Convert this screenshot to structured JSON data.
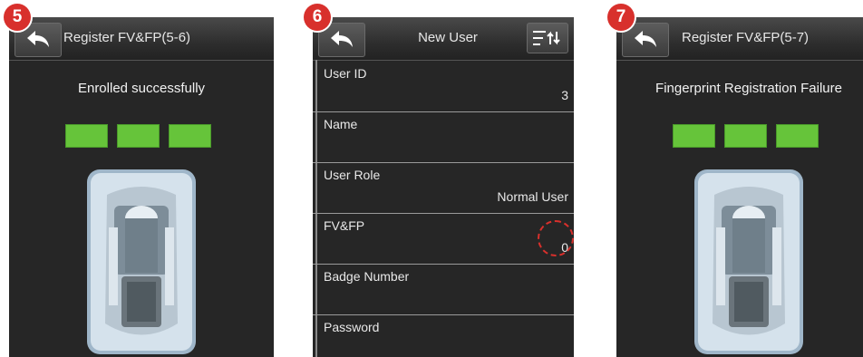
{
  "screens": [
    {
      "step": "5",
      "title": "Register FV&FP(5-6)",
      "message": "Enrolled successfully",
      "progress_filled": 3,
      "progress_total": 3
    },
    {
      "step": "6",
      "title": "New User",
      "fields": [
        {
          "label": "User ID",
          "value": "3"
        },
        {
          "label": "Name",
          "value": ""
        },
        {
          "label": "User Role",
          "value": "Normal User"
        },
        {
          "label": "FV&FP",
          "value": "0"
        },
        {
          "label": "Badge Number",
          "value": ""
        },
        {
          "label": "Password",
          "value": ""
        }
      ]
    },
    {
      "step": "7",
      "title": "Register FV&FP(5-7)",
      "message": "Fingerprint Registration Failure",
      "progress_filled": 3,
      "progress_total": 3
    }
  ],
  "icons": {
    "back": "back-arrow-icon",
    "sort": "sort-icon",
    "device": "fingerprint-scanner-icon"
  },
  "colors": {
    "screen_bg": "#262626",
    "progress_fill": "#66c43a",
    "step_badge": "#d8302c"
  }
}
